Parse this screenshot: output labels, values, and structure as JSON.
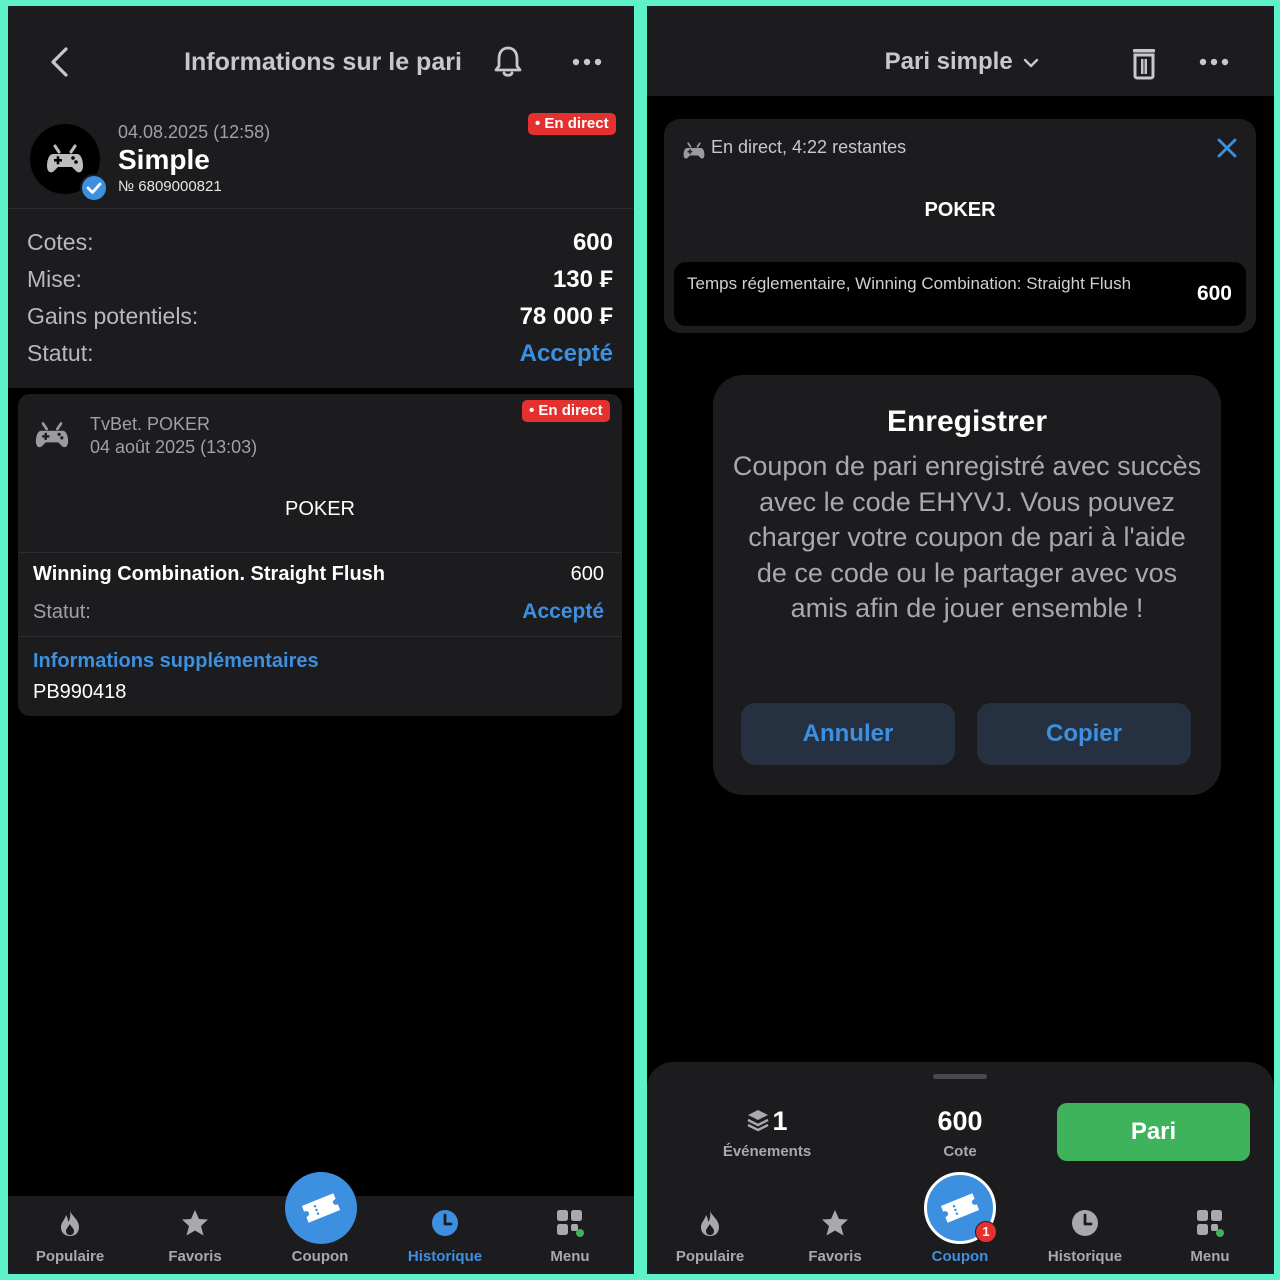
{
  "left": {
    "header": {
      "title": "Informations sur le pari"
    },
    "bet": {
      "date": "04.08.2025 (12:58)",
      "type": "Simple",
      "number": "№ 6809000821",
      "live_badge": "• En direct"
    },
    "summary": [
      {
        "label": "Cotes:",
        "value": "600"
      },
      {
        "label": "Mise:",
        "value": "130 ₣"
      },
      {
        "label": "Gains potentiels:",
        "value": "78 000 ₣"
      },
      {
        "label": "Statut:",
        "value": "Accepté"
      }
    ],
    "event": {
      "live_badge": "• En direct",
      "league": "TvBet. POKER",
      "date": "04 août 2025 (13:03)",
      "game": "POKER",
      "outcome": "Winning Combination. Straight Flush",
      "odds": "600",
      "status_label": "Statut:",
      "status_value": "Accepté",
      "more_title": "Informations supplémentaires",
      "more_code": "PB990418"
    }
  },
  "right": {
    "header": {
      "title": "Pari simple"
    },
    "coupon": {
      "live_text": "En direct, 4:22 restantes",
      "game": "POKER",
      "market": "Temps réglementaire, Winning Combination: Straight Flush",
      "odds": "600"
    },
    "dialog": {
      "title": "Enregistrer",
      "message": "Coupon de pari enregistré avec succès avec le code EHYVJ. Vous pouvez charger votre coupon de pari à l'aide de ce code ou le partager avec vos amis afin de jouer ensemble !",
      "cancel": "Annuler",
      "copy": "Copier"
    },
    "sheet": {
      "events_count": "1",
      "events_label": "Événements",
      "odds_value": "600",
      "odds_label": "Cote",
      "bet_button": "Pari"
    },
    "coupon_badge": "1"
  },
  "nav": {
    "items": [
      "Populaire",
      "Favoris",
      "Coupon",
      "Historique",
      "Menu"
    ]
  },
  "colors": {
    "accent_blue": "#3d8fe0",
    "live_red": "#e4302f",
    "bet_green": "#3fb35c",
    "frame": "#5ef2c9"
  }
}
